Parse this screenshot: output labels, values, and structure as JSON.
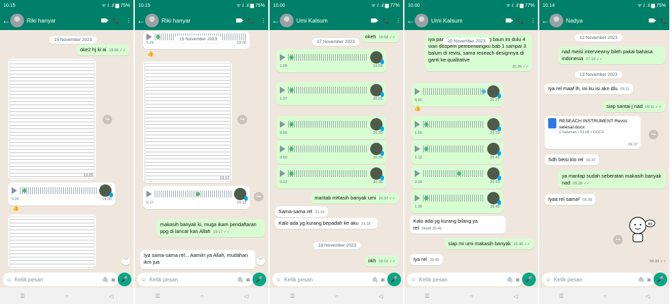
{
  "colors": {
    "header": "#008069",
    "chat_bg": "#efe7de",
    "outgoing": "#d9fdd3",
    "incoming": "#ffffff",
    "accent": "#00a884",
    "read_tick": "#53bdeb"
  },
  "icons": {
    "back": "arrow-left-icon",
    "video": "video-camera-icon",
    "call": "phone-icon",
    "menu": "more-vertical-icon",
    "emoji": "emoji-icon",
    "attach": "paperclip-icon",
    "camera": "camera-icon",
    "mic": "mic-icon"
  },
  "input_placeholder": "Ketik pesan",
  "panels": [
    {
      "status_time": "10.15",
      "status_icons": "ᯤ ⅈ .ıl ▆ 75%",
      "contact": "Riki hanyar",
      "date1": "15 November 2023",
      "msg1": "oke2 hj ki ai",
      "msg1_time": "18.55 ✓✓",
      "doc1_time": "19.05",
      "voice_dur": "5.29",
      "voice_time": "19.05"
    },
    {
      "status_time": "10.15",
      "status_icons": "ᯤ ⅈ .ıl ▆ 75%",
      "contact": "Riki hanyar",
      "date1": "15 November 2023",
      "top_voice_dur": "5.29",
      "top_voice_time": "19.05",
      "doc_time": "19.12",
      "voice_dur": "6.17",
      "voice_time": "19.12",
      "msg1": "makasih banyak ki, muga ikam pendaftaran ppg di lancar kan Allah",
      "msg1_time": "19.17 ✓✓",
      "msg2": "Iya sama-sama rel... Aamiin ya Allah, mudahan ikm jua"
    },
    {
      "status_time": "10.00",
      "status_icons": "ᯤ ⅈ .ıl ▆ 77%",
      "contact": "Umi Kalsum",
      "top_msg": "okeh",
      "top_time": "19.58 ✓✓",
      "date1": "17 November 2023",
      "voices": [
        {
          "d": "1.09",
          "t": "19.59"
        },
        {
          "d": "1.07",
          "t": "20.01"
        },
        {
          "d": "0.55",
          "t": "20.35"
        },
        {
          "d": "0.50",
          "t": "20.36"
        },
        {
          "d": "0.22",
          "t": "20.36"
        }
      ],
      "msg1": "mantab mKasih banyak umi",
      "msg1_time": "20.37 ✓✓",
      "msg2": "Sama-sama rel",
      "msg2_time": "21.15",
      "msg3": "Kalo ada yg kurang bepadah ke aku",
      "msg3_time": "21.15",
      "date2": "18 November 2023",
      "msg4": "okh",
      "msg4_time": "09.10 ✓✓"
    },
    {
      "status_time": "10.00",
      "status_icons": "ᯤ ⅈ .ıl ▆ 77%",
      "contact": "Umi Kalsum",
      "top_msg": "iya pan                                disuruh menumbung baun ini dulu 4 wan dospem pembimbingku bab 1 sampai 3 balum di revisi, sama reseach designnya di ganti ke qualitative",
      "top_date": "20 November 2023",
      "top_time": "20.36 ✓✓",
      "voices": [
        {
          "d": "0.50",
          "t": "20.37"
        },
        {
          "d": "1.50",
          "t": "20.39"
        },
        {
          "d": "1.12",
          "t": "20.41"
        },
        {
          "d": "2.03",
          "t": "20.43"
        },
        {
          "d": "1.36",
          "t": "20.45"
        }
      ],
      "msg1": "Kalo ada yg kurang bilang ya rel",
      "msg1_time": "Diedit 20.45",
      "msg2": "siap mi umi makasih banyak",
      "msg2_time": "20.46 ✓✓",
      "msg3": "Iya rel",
      "msg3_time": "20.46"
    },
    {
      "status_time": "10.14",
      "status_icons": "ᯤ ⅈ .ıl ▆ 75%",
      "contact": "Nadya",
      "date1": "12 November 2023",
      "msg1": "nad meisi interviewny bileh pakai bahasa indonesia",
      "msg1_time": "07.18 ✓✓",
      "date2": "13 November 2023",
      "msg2": "Iya rel maaf lh, ini ku isi akn dlu",
      "msg2_time": "09.11",
      "msg3": "siap santai j nad",
      "msg3_time": "09.11 ✓✓",
      "file_name": "RESEACH INSTRUMENT Revisi selesai.docx",
      "file_meta": "1 halaman • 51 kB • DOCX",
      "file_time": "09.37",
      "msg4": "Sdh beisi klo rel",
      "msg4_time": "09.37",
      "msg5": "ya mantap sudah seberatan makasih banyak nad",
      "msg5_time": "09.38 ✓✓",
      "msg6": "Iyaa rel sama²",
      "msg6_time": "09.39",
      "sticker_text": "sip",
      "sticker_time": "09.39 ✓✓"
    }
  ]
}
